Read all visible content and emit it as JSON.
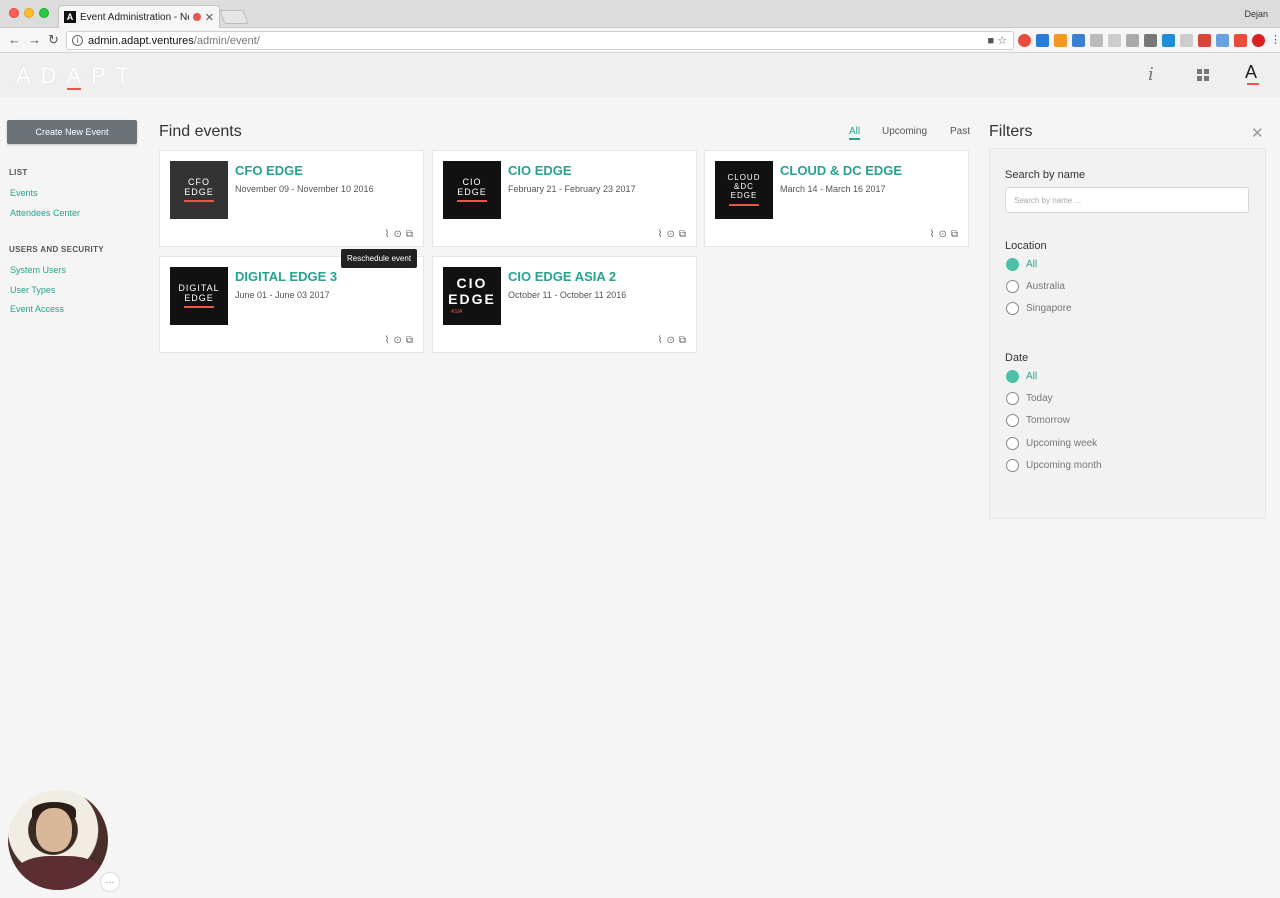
{
  "browser": {
    "tab_title": "Event Administration - Nexi",
    "tab_favicon": "A",
    "profile": "Dejan",
    "url_host": "admin.adapt.ventures",
    "url_path": "/admin/event/"
  },
  "header": {
    "logo": "ADAPT",
    "info": "i",
    "avatar_letter": "A"
  },
  "sidebar": {
    "create_button": "Create New Event",
    "list_heading": "LIST",
    "list_items": [
      "Events",
      "Attendees Center"
    ],
    "security_heading": "USERS AND SECURITY",
    "security_items": [
      "System Users",
      "User Types",
      "Event Access"
    ]
  },
  "main": {
    "title": "Find events",
    "tabs": [
      "All",
      "Upcoming",
      "Past"
    ],
    "active_tab": "All",
    "tooltip": "Reschedule event",
    "events": [
      {
        "title": "CFO EDGE",
        "dates": "November 09 - November 10 2016",
        "thumb_lines": [
          "CFO",
          "EDGE"
        ]
      },
      {
        "title": "CIO EDGE",
        "dates": "February 21 - February 23 2017",
        "thumb_lines": [
          "CIO",
          "EDGE"
        ]
      },
      {
        "title": "CLOUD & DC EDGE",
        "dates": "March 14 - March 16 2017",
        "thumb_lines": [
          "CLOUD",
          "&DC",
          "EDGE"
        ]
      },
      {
        "title": "DIGITAL EDGE 3",
        "dates": "June 01 - June 03 2017",
        "thumb_lines": [
          "DIGITAL",
          "EDGE"
        ]
      },
      {
        "title": "CIO EDGE ASIA 2",
        "dates": "October 11 - October 11 2016",
        "thumb_lines": [
          "CIO",
          "EDGE"
        ],
        "thumb_sub": "ASIA"
      }
    ]
  },
  "filters": {
    "title": "Filters",
    "search_label": "Search by name",
    "search_placeholder": "Search by name ...",
    "location_label": "Location",
    "location_options": [
      "All",
      "Australia",
      "Singapore"
    ],
    "location_selected": "All",
    "date_label": "Date",
    "date_options": [
      "All",
      "Today",
      "Tomorrow",
      "Upcoming week",
      "Upcoming month"
    ],
    "date_selected": "All"
  },
  "colors": {
    "accent": "#25a38e",
    "radio_selected": "#4dc0a8",
    "brand_red": "#e8584a",
    "create_button": "#6b7379"
  }
}
